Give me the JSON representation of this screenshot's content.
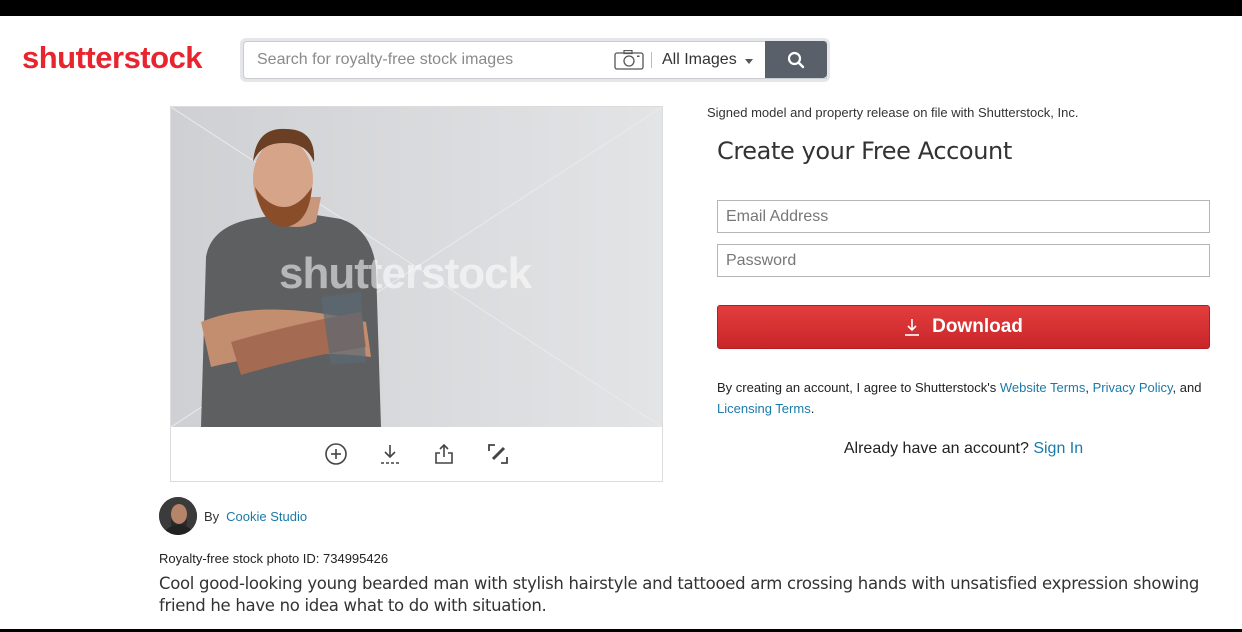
{
  "brand": {
    "logo_text": "shutterstock",
    "accent_color": "#e8242f"
  },
  "search": {
    "placeholder": "Search for royalty-free stock images",
    "value": "",
    "camera_icon": "camera-icon",
    "filter_label": "All Images",
    "submit_icon": "search-icon"
  },
  "image": {
    "watermark": "shutterstock",
    "actions": [
      {
        "name": "add-to-collection",
        "icon": "plus-circle-icon"
      },
      {
        "name": "download",
        "icon": "download-icon"
      },
      {
        "name": "share",
        "icon": "share-icon"
      },
      {
        "name": "edit",
        "icon": "edit-icon"
      }
    ]
  },
  "signup": {
    "release_note": "Signed model and property release on file with Shutterstock, Inc.",
    "title": "Create your Free Account",
    "email_placeholder": "Email Address",
    "password_placeholder": "Password",
    "download_label": "Download",
    "terms_prefix": "By creating an account, I agree to Shutterstock's ",
    "terms_link_1": "Website Terms",
    "terms_sep_1": ", ",
    "terms_link_2": "Privacy Policy",
    "terms_sep_2": ", and",
    "terms_link_3": "Licensing Terms",
    "terms_end": ".",
    "already_text": "Already have an account? ",
    "signin_label": "Sign In",
    "button_color": "#d6302f",
    "link_color": "#1c7aa8"
  },
  "details": {
    "by_label": "By",
    "author_name": "Cookie Studio",
    "photo_id": "Royalty-free stock photo ID: 734995426",
    "description": "Cool good-looking young bearded man with stylish hairstyle and tattooed arm crossing hands with unsatisfied expression showing friend he have no idea what to do with situation."
  }
}
